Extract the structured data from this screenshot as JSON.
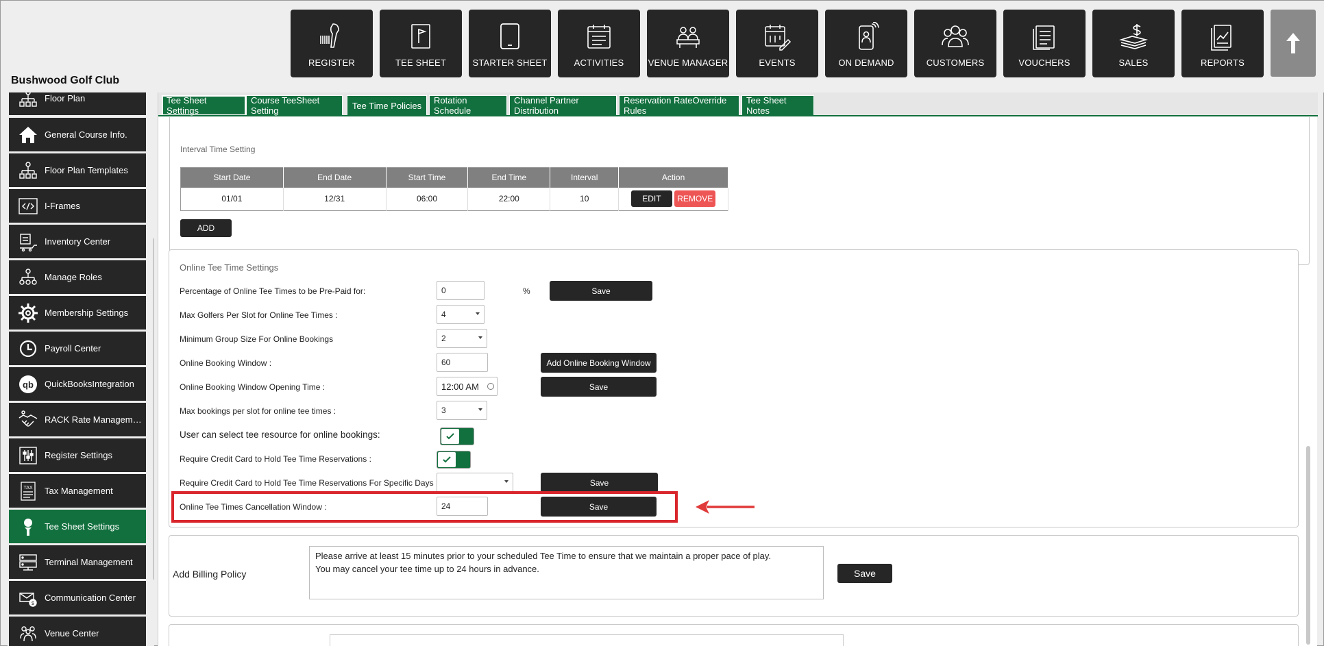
{
  "club_name": "Bushwood Golf Club",
  "top_nav": [
    {
      "label": "REGISTER",
      "icon": "barcode-scanner-icon"
    },
    {
      "label": "TEE SHEET",
      "icon": "flag-sheet-icon"
    },
    {
      "label": "STARTER SHEET",
      "icon": "tablet-icon"
    },
    {
      "label": "ACTIVITIES",
      "icon": "calendar-list-icon"
    },
    {
      "label": "VENUE MANAGER",
      "icon": "meeting-table-icon"
    },
    {
      "label": "EVENTS",
      "icon": "calendar-pencil-icon"
    },
    {
      "label": "ON DEMAND",
      "icon": "phone-user-icon"
    },
    {
      "label": "CUSTOMERS",
      "icon": "users-icon"
    },
    {
      "label": "VOUCHERS",
      "icon": "document-stack-icon"
    },
    {
      "label": "SALES",
      "icon": "money-stack-icon"
    },
    {
      "label": "REPORTS",
      "icon": "report-chart-icon"
    }
  ],
  "sidebar": {
    "items": [
      {
        "label": "Floor Plan",
        "icon": "floor-plan-icon"
      },
      {
        "label": "General Course Info.",
        "icon": "home-icon"
      },
      {
        "label": "Floor Plan Templates",
        "icon": "org-chart-icon"
      },
      {
        "label": "I-Frames",
        "icon": "code-icon"
      },
      {
        "label": "Inventory Center",
        "icon": "inventory-icon"
      },
      {
        "label": "Manage Roles",
        "icon": "roles-icon"
      },
      {
        "label": "Membership Settings",
        "icon": "gear-icon"
      },
      {
        "label": "Payroll Center",
        "icon": "clock-icon"
      },
      {
        "label": "QuickBooksIntegration",
        "icon": "quickbooks-icon"
      },
      {
        "label": "RACK Rate Management",
        "icon": "handshake-icon"
      },
      {
        "label": "Register Settings",
        "icon": "sliders-icon"
      },
      {
        "label": "Tax Management",
        "icon": "tax-icon"
      },
      {
        "label": "Tee Sheet Settings",
        "icon": "golf-tee-icon",
        "active": true
      },
      {
        "label": "Terminal Management",
        "icon": "terminal-icon"
      },
      {
        "label": "Communication Center",
        "icon": "communication-icon"
      },
      {
        "label": "Venue Center",
        "icon": "venue-icon"
      }
    ]
  },
  "tabs": [
    "Tee Sheet Settings",
    "Course TeeSheet Setting",
    "Tee Time Policies",
    "Rotation Schedule",
    "Channel Partner Distribution",
    "Reservation RateOverride Rules",
    "Tee Sheet Notes"
  ],
  "interval": {
    "title": "Interval Time Setting",
    "headers": [
      "Start Date",
      "End Date",
      "Start Time",
      "End Time",
      "Interval",
      "Action"
    ],
    "row": [
      "01/01",
      "12/31",
      "06:00",
      "22:00",
      "10"
    ],
    "edit_label": "EDIT",
    "remove_label": "REMOVE",
    "add_label": "ADD"
  },
  "online": {
    "title": "Online Tee Time Settings",
    "prepaid_label": "Percentage of Online Tee Times to be Pre-Paid for:",
    "prepaid_value": "0",
    "percent_symbol": "%",
    "max_golfers_label": "Max Golfers Per Slot for Online Tee Times :",
    "max_golfers_value": "4",
    "min_group_label": "Minimum Group Size For Online Bookings",
    "min_group_value": "2",
    "booking_window_label": "Online Booking Window :",
    "booking_window_value": "60",
    "add_window_label": "Add Online Booking Window",
    "opening_time_label": "Online Booking Window Opening Time :",
    "opening_time_value": "12:00 AM",
    "max_bookings_label": "Max bookings per slot for online tee times :",
    "max_bookings_value": "3",
    "select_resource_label": "User can select tee resource for online bookings:",
    "require_cc_label": "Require Credit Card to Hold Tee Time Reservations :",
    "require_cc_days_label": "Require Credit Card to Hold Tee Time Reservations For Specific Days :",
    "cancel_window_label": "Online Tee Times Cancellation Window :",
    "cancel_window_value": "24",
    "save_label": "Save"
  },
  "billing": {
    "label": "Add Billing Policy",
    "text_line1": "Please arrive at least 15 minutes prior to your scheduled Tee Time to ensure that we maintain a proper pace of play.",
    "text_line2": "You may cancel your tee time up to 24 hours in advance.",
    "save_label": "Save"
  },
  "colors": {
    "brand_green": "#12703e",
    "nav_dark": "#262626",
    "highlight_red": "#d9262c",
    "remove_red": "#ee5555"
  }
}
